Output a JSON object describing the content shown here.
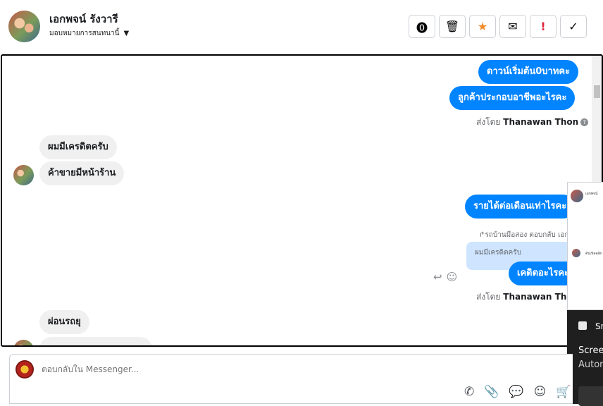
{
  "header": {
    "contact_name": "เอกพจน์ รังวารี",
    "assign_label": "มอบหมายการสนทนานี้",
    "toolbar": [
      {
        "name": "report-spam-button",
        "icon": "exclamation-circle-icon",
        "glyph": "❗"
      },
      {
        "name": "delete-button",
        "icon": "trash-icon",
        "glyph": "🗑"
      },
      {
        "name": "star-button",
        "icon": "star-icon",
        "glyph": "★"
      },
      {
        "name": "mark-unread-button",
        "icon": "envelope-icon",
        "glyph": "✉"
      },
      {
        "name": "follow-up-button",
        "icon": "exclamation-icon",
        "glyph": "!"
      },
      {
        "name": "mark-done-button",
        "icon": "check-icon",
        "glyph": "✓"
      }
    ]
  },
  "messages": {
    "out_1": "ดาวน์เริ่มต้น0บาทคะ",
    "out_2": "ลูกค้าประกอบอาชีพอะไรคะ",
    "sent_by_1_prefix": "ส่งโดย",
    "sent_by_1_name": "Thanawan Thon",
    "in_1": "ผมมีเครดิตครับ",
    "in_2": "ค้าขายมีหน้าร้าน",
    "out_3": "รายได้ต่อเดือนเท่าไรคะ",
    "reply_note": "รถบ้านมือสอง ตอบกลับ เอกพจน์",
    "quoted_text": "ผมมีเครดิตครับ",
    "out_4": "เคดิตอะไรคะ",
    "sent_by_2_prefix": "ส่งโดย",
    "sent_by_2_name": "Thanawan Thon",
    "in_3": "ผ่อนรถยุ"
  },
  "overlay": {
    "panel_name": "เอกพจน์",
    "panel_snippet": "ดับเบิลคลิก",
    "toast_title": "Sn",
    "toast_heading": "Screen",
    "toast_sub": "Autom"
  },
  "composer": {
    "placeholder": "ตอบกลับใน Messenger..."
  },
  "colors": {
    "accent_blue": "#0084ff",
    "incoming_gray": "#f0f0f0",
    "quoted_blue": "#cfe5ff"
  }
}
